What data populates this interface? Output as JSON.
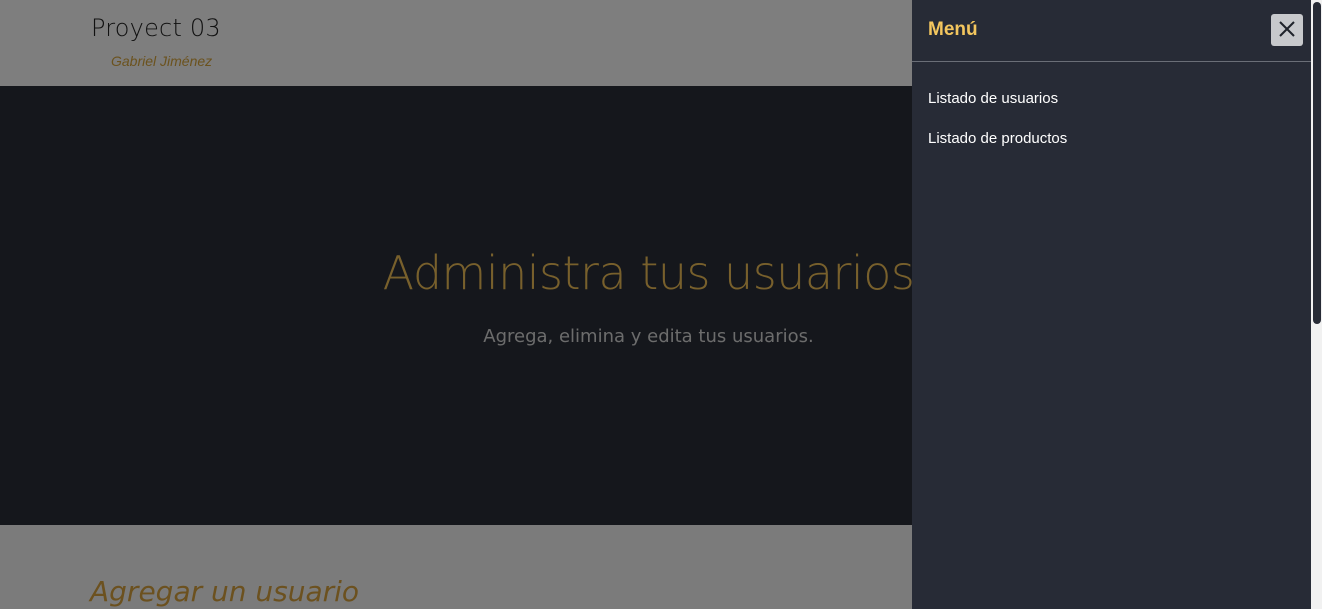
{
  "navbar": {
    "brand": "Proyect 03",
    "author": "Gabriel Jiménez"
  },
  "hero": {
    "title": "Administra tus usuarios",
    "subtitle": "Agrega, elimina y edita tus usuarios."
  },
  "section": {
    "title": "Agregar un usuario"
  },
  "offcanvas": {
    "title": "Menú",
    "close_icon": "close-icon",
    "links": [
      {
        "label": "Listado de usuarios"
      },
      {
        "label": "Listado de productos"
      }
    ]
  },
  "colors": {
    "accent": "#f3c65e",
    "hero_bg": "#2a2f39",
    "panel_bg": "#272b36"
  }
}
